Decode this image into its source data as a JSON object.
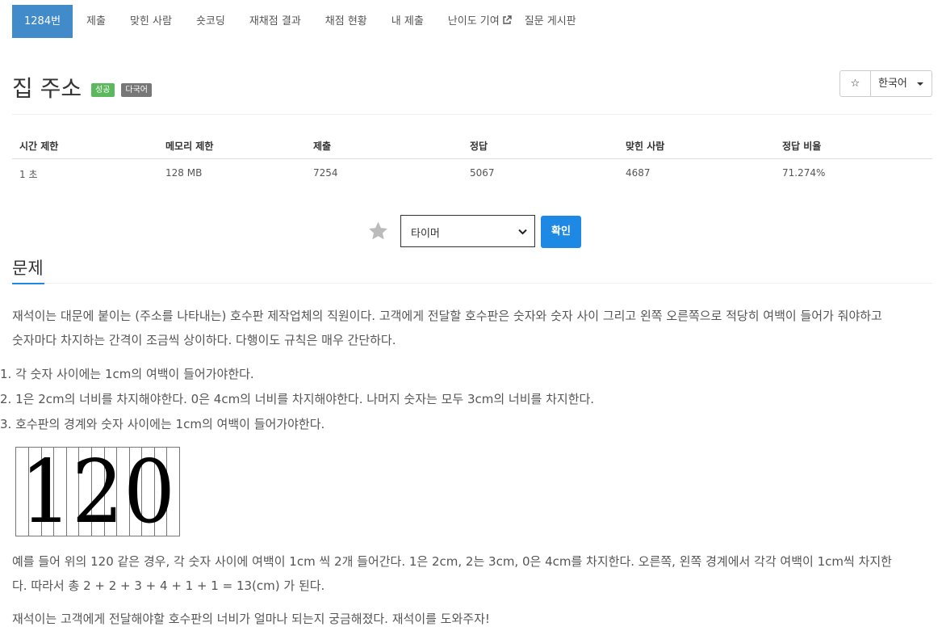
{
  "nav": {
    "items": [
      {
        "label": "1284번"
      },
      {
        "label": "제출"
      },
      {
        "label": "맞힌 사람"
      },
      {
        "label": "숏코딩"
      },
      {
        "label": "재채점 결과"
      },
      {
        "label": "채점 현황"
      },
      {
        "label": "내 제출"
      },
      {
        "label": "난이도 기여"
      },
      {
        "label": "질문 게시판"
      }
    ]
  },
  "header": {
    "title": "집 주소",
    "badge_success": "성공",
    "badge_multi": "다국어",
    "star_glyph": "☆",
    "language": "한국어",
    "colors": {
      "success": "#5cb85c",
      "multi": "#777777",
      "active_tab": "#428bca",
      "primary": "#1e88e5"
    }
  },
  "stats": {
    "headers": [
      "시간 제한",
      "메모리 제한",
      "제출",
      "정답",
      "맞힌 사람",
      "정답 비율"
    ],
    "values": [
      "1 초",
      "128 MB",
      "7254",
      "5067",
      "4687",
      "71.274%"
    ]
  },
  "timer": {
    "select_value": "타이머",
    "confirm_label": "확인"
  },
  "problem": {
    "section_title": "문제",
    "intro_1": "재석이는 대문에 붙이는 (주소를 나타내는) 호수판 제작업체의 직원이다. 고객에게 전달할 호수판은 숫자와 숫자 사이 그리고 왼쪽 오른쪽으로 적당히 여백이 들어가 줘야하고",
    "intro_2": "숫자마다 차지하는 간격이 조금씩 상이하다. 다행이도 규칙은 매우 간단하다.",
    "rules": [
      "1. 각 숫자 사이에는 1cm의 여백이 들어가야한다.",
      "2. 1은 2cm의 너비를 차지해야한다. 0은 4cm의 너비를 차지해야한다. 나머지 숫자는 모두 3cm의 너비를 차지한다.",
      "3. 호수판의 경계와 숫자 사이에는 1cm의 여백이 들어가야한다."
    ],
    "figure_text": "120",
    "example_1": "예를 들어 위의 120 같은 경우,  각 숫자 사이에 여백이 1cm 씩 2개 들어간다. 1은 2cm, 2는 3cm, 0은 4cm를 차지한다. 오른쪽, 왼쪽 경계에서 각각 여백이 1cm씩 차지한",
    "example_2": "다. 따라서 총 2 + 2 + 3 + 4 + 1 + 1 = 13(cm) 가 된다.",
    "closing": "재석이는 고객에게 전달해야할 호수판의 너비가 얼마나 되는지 궁금해졌다. 재석이를 도와주자!"
  }
}
